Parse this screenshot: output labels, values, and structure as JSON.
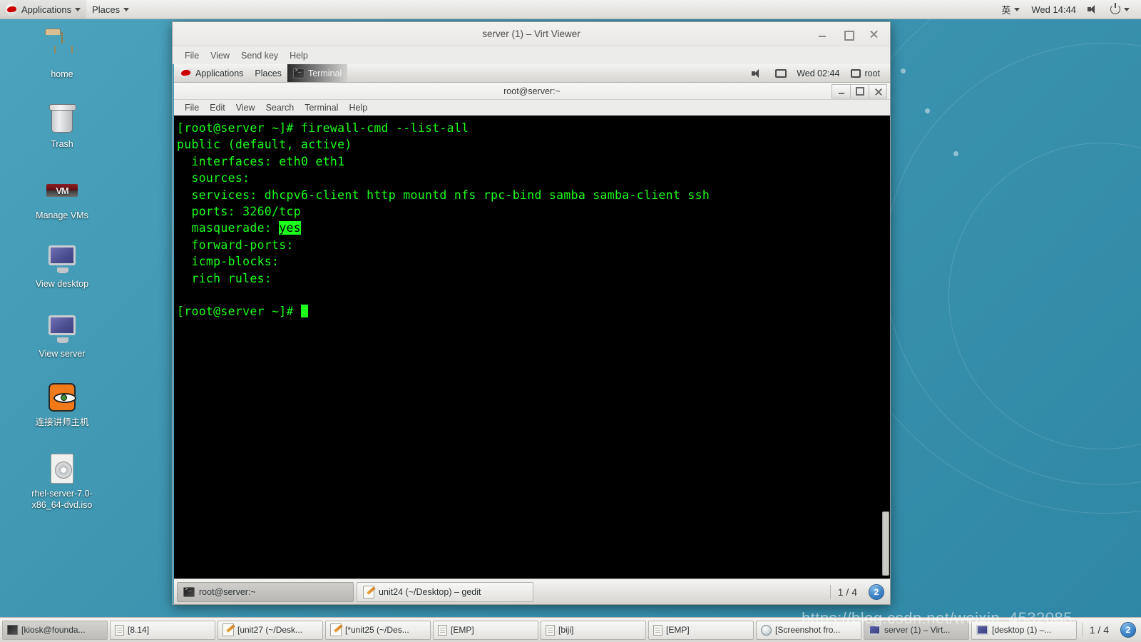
{
  "host_panel": {
    "logo_icon": "redhat-logo-icon",
    "applications_label": "Applications",
    "places_label": "Places",
    "input_method": "英",
    "clock": "Wed 14:44",
    "volume_icon": "volume-muted-icon",
    "power_icon": "power-icon"
  },
  "desktop_icons": [
    {
      "label": "home",
      "icon": "folder-icon"
    },
    {
      "label": "Trash",
      "icon": "trash-icon"
    },
    {
      "label": "Manage VMs",
      "icon": "vm-icon",
      "glyph_text": "VM"
    },
    {
      "label": "View desktop",
      "icon": "monitor-icon"
    },
    {
      "label": "View server",
      "icon": "monitor-icon"
    },
    {
      "label": "连接讲师主机",
      "icon": "vnc-face-icon"
    },
    {
      "label": "rhel-server-7.0-x86_64-dvd.iso",
      "icon": "iso-disc-icon"
    }
  ],
  "virt_viewer": {
    "title": "server (1) – Virt Viewer",
    "menus": [
      "File",
      "View",
      "Send key",
      "Help"
    ],
    "window_buttons": {
      "minimize": "minimize-icon",
      "maximize": "maximize-icon",
      "close": "close-icon"
    }
  },
  "guest_panel": {
    "applications_label": "Applications",
    "places_label": "Places",
    "window_label": "Terminal",
    "window_icon": "terminal-icon",
    "volume_icon": "volume-icon",
    "network_icon": "network-disconnected-icon",
    "clock": "Wed 02:44",
    "user_icon": "chat-icon",
    "user_label": "root"
  },
  "terminal": {
    "title": "root@server:~",
    "menus": [
      "File",
      "Edit",
      "View",
      "Search",
      "Terminal",
      "Help"
    ],
    "window_buttons": {
      "minimize": "minimize-icon",
      "maximize": "maximize-icon",
      "close": "close-icon"
    },
    "lines": [
      {
        "text": "[root@server ~]# firewall-cmd --list-all"
      },
      {
        "text": "public (default, active)"
      },
      {
        "text": "  interfaces: eth0 eth1"
      },
      {
        "text": "  sources:"
      },
      {
        "text": "  services: dhcpv6-client http mountd nfs rpc-bind samba samba-client ssh"
      },
      {
        "text": "  ports: 3260/tcp"
      },
      {
        "text": "  masquerade: ",
        "highlight": "yes"
      },
      {
        "text": "  forward-ports:"
      },
      {
        "text": "  icmp-blocks:"
      },
      {
        "text": "  rich rules:"
      },
      {
        "text": ""
      },
      {
        "text": "[root@server ~]# ",
        "cursor": true
      }
    ],
    "foreground_color": "#1dff1d",
    "background_color": "#000000"
  },
  "guest_taskbar": {
    "items": [
      {
        "label": "root@server:~",
        "icon": "terminal-icon",
        "active": true
      },
      {
        "label": "unit24 (~/Desktop) – gedit",
        "icon": "gedit-icon",
        "active": false
      }
    ],
    "workspace": "1 / 4",
    "badge": "2"
  },
  "host_taskbar": {
    "items": [
      {
        "label": "[kiosk@founda...",
        "icon": "terminal-icon",
        "active": true
      },
      {
        "label": "[8.14]",
        "icon": "document-icon",
        "active": false
      },
      {
        "label": "[unit27 (~/Desk...",
        "icon": "gedit-icon",
        "active": false
      },
      {
        "label": "[*unit25 (~/Des...",
        "icon": "gedit-icon",
        "active": false
      },
      {
        "label": "[EMP]",
        "icon": "document-icon",
        "active": false
      },
      {
        "label": "[biji]",
        "icon": "document-icon",
        "active": false
      },
      {
        "label": "[EMP]",
        "icon": "document-icon",
        "active": false
      },
      {
        "label": "[Screenshot fro...",
        "icon": "screenshot-icon",
        "active": false
      },
      {
        "label": "server (1) – Virt...",
        "icon": "monitor-icon",
        "active": true
      },
      {
        "label": "[desktop (1) –...",
        "icon": "monitor-icon",
        "active": false
      }
    ],
    "workspace": "1 / 4",
    "badge": "2"
  },
  "watermark": "https://blog.csdn.net/weixin_4532085"
}
